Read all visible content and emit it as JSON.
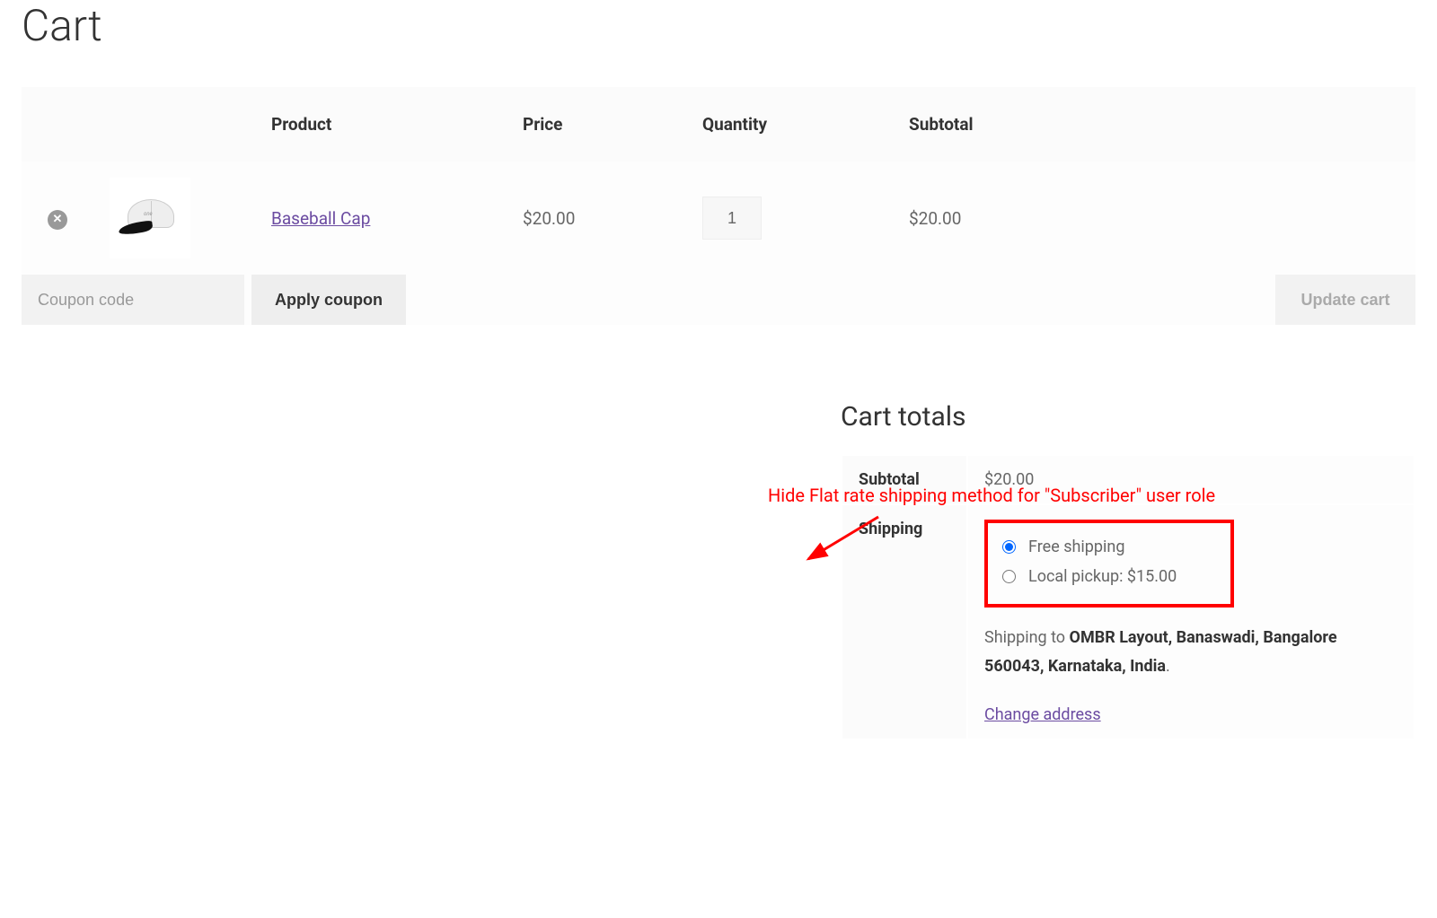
{
  "page": {
    "title": "Cart"
  },
  "table": {
    "headers": {
      "product": "Product",
      "price": "Price",
      "quantity": "Quantity",
      "subtotal": "Subtotal"
    }
  },
  "items": [
    {
      "name": "Baseball Cap",
      "price": "$20.00",
      "quantity": "1",
      "subtotal": "$20.00"
    }
  ],
  "actions": {
    "coupon_placeholder": "Coupon code",
    "apply_coupon": "Apply coupon",
    "update_cart": "Update cart"
  },
  "totals": {
    "title": "Cart totals",
    "subtotal_label": "Subtotal",
    "subtotal_value": "$20.00",
    "shipping_label": "Shipping",
    "shipping_options": [
      {
        "label": "Free shipping",
        "selected": true
      },
      {
        "label": "Local pickup: $15.00",
        "selected": false
      }
    ],
    "shipping_to_prefix": "Shipping to ",
    "shipping_address": "OMBR Layout, Banaswadi, Bangalore 560043, Karnataka, India",
    "shipping_to_suffix": ".",
    "change_address": "Change address"
  },
  "annotation": {
    "text": "Hide Flat rate shipping method for \"Subscriber\" user role"
  }
}
